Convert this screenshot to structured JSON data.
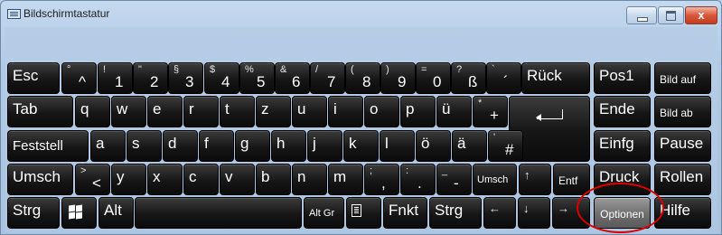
{
  "window": {
    "title": "Bildschirmtastatur",
    "close_glyph": "x"
  },
  "keys": {
    "esc": "Esc",
    "num_row": [
      {
        "top": "°",
        "bottom": "^"
      },
      {
        "top": "!",
        "bottom": "1"
      },
      {
        "top": "\"",
        "bottom": "2"
      },
      {
        "top": "§",
        "bottom": "3"
      },
      {
        "top": "$",
        "bottom": "4"
      },
      {
        "top": "%",
        "bottom": "5"
      },
      {
        "top": "&",
        "bottom": "6"
      },
      {
        "top": "/",
        "bottom": "7"
      },
      {
        "top": "(",
        "bottom": "8"
      },
      {
        "top": ")",
        "bottom": "9"
      },
      {
        "top": "=",
        "bottom": "0"
      },
      {
        "top": "?",
        "bottom": "ß"
      },
      {
        "top": "`",
        "bottom": "´"
      }
    ],
    "ruck": "Rück",
    "pos1": "Pos1",
    "bild_auf": "Bild auf",
    "tab": "Tab",
    "row_q": [
      "q",
      "w",
      "e",
      "r",
      "t",
      "z",
      "u",
      "i",
      "o",
      "p",
      "ü"
    ],
    "plus": {
      "top": "*",
      "bottom": "+"
    },
    "ende": "Ende",
    "bild_ab": "Bild ab",
    "feststell": "Feststell",
    "row_a": [
      "a",
      "s",
      "d",
      "f",
      "g",
      "h",
      "j",
      "k",
      "l",
      "ö",
      "ä"
    ],
    "hash": {
      "top": "'",
      "bottom": "#"
    },
    "einfg": "Einfg",
    "pause": "Pause",
    "umschalt_left": "Umsch",
    "angle": {
      "top": ">",
      "bottom": "<"
    },
    "row_y": [
      "y",
      "x",
      "c",
      "v",
      "b",
      "n",
      "m"
    ],
    "comma": {
      "top": ";",
      "bottom": ","
    },
    "dot": {
      "top": ":",
      "bottom": "."
    },
    "dash": {
      "top": "_",
      "bottom": "-"
    },
    "umschalt_right": "Umsch",
    "arrow_up": "↑",
    "entf": "Entf",
    "druck": "Druck",
    "rollen": "Rollen",
    "strg_left": "Strg",
    "alt": "Alt",
    "altgr": "Alt Gr",
    "fnkt": "Fnkt",
    "strg_right": "Strg",
    "arrow_left": "←",
    "arrow_down": "↓",
    "arrow_right": "→",
    "optionen": "Optionen",
    "hilfe": "Hilfe"
  },
  "icons": {
    "app": "keyboard-icon",
    "windows": "windows-logo-icon",
    "menu": "context-menu-icon",
    "enter": "enter-arrow-icon"
  },
  "colors": {
    "key": "#161616",
    "options_key": "#6e6e6e",
    "highlight_ring": "#e00000"
  }
}
